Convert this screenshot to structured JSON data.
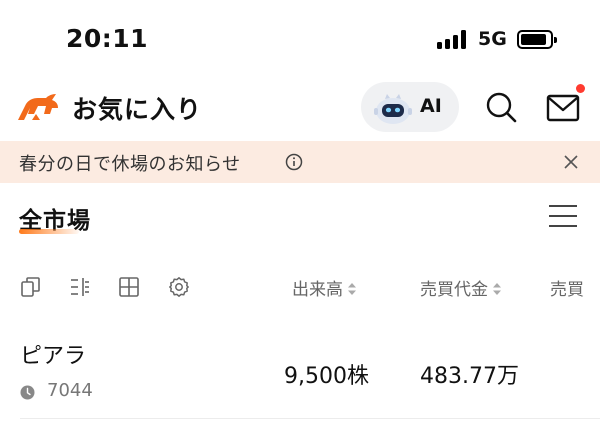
{
  "status_bar": {
    "time": "20:11",
    "network": "5G"
  },
  "header": {
    "title": "お気に入り",
    "ai_label": "AI"
  },
  "notice": {
    "text": "春分の日で休場のお知らせ"
  },
  "market": {
    "tab_label": "全市場"
  },
  "columns": {
    "volume": "出来高",
    "turnover": "売買代金",
    "partial": "売買"
  },
  "rows": [
    {
      "name": "ピアラ",
      "code": "7044",
      "volume": "9,500株",
      "turnover": "483.77万"
    }
  ],
  "colors": {
    "accent": "#ff7a1a",
    "notice_bg": "#fcebe1",
    "badge_dot": "#ff3b30"
  }
}
